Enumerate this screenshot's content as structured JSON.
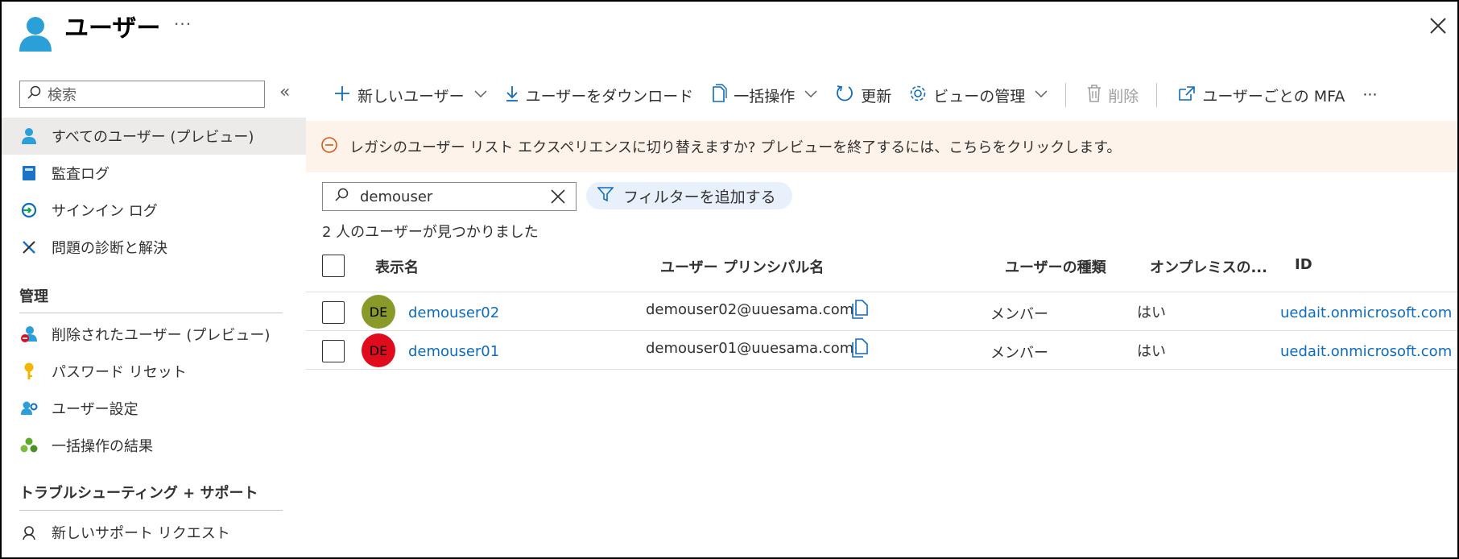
{
  "header": {
    "title": "ユーザー",
    "more": "···"
  },
  "sidebar": {
    "search_placeholder": "検索",
    "collapse": "«",
    "items": [
      {
        "label": "すべてのユーザー (プレビュー)",
        "icon": "user-icon"
      },
      {
        "label": "監査ログ",
        "icon": "book-icon"
      },
      {
        "label": "サインイン ログ",
        "icon": "signin-icon"
      },
      {
        "label": "問題の診断と解決",
        "icon": "wrench-icon"
      }
    ],
    "section_manage": "管理",
    "manage_items": [
      {
        "label": "削除されたユーザー (プレビュー)",
        "icon": "deleted-user-icon"
      },
      {
        "label": "パスワード リセット",
        "icon": "key-icon"
      },
      {
        "label": "ユーザー設定",
        "icon": "user-settings-icon"
      },
      {
        "label": "一括操作の結果",
        "icon": "bulk-results-icon"
      }
    ],
    "section_support": "トラブルシューティング + サポート",
    "support_items": [
      {
        "label": "新しいサポート リクエスト",
        "icon": "support-icon"
      }
    ]
  },
  "toolbar": {
    "new_user": "新しいユーザー",
    "download": "ユーザーをダウンロード",
    "bulk": "一括操作",
    "refresh": "更新",
    "manage_view": "ビューの管理",
    "delete": "削除",
    "mfa": "ユーザーごとの MFA",
    "more": "···"
  },
  "banner": {
    "text": "レガシのユーザー リスト エクスペリエンスに切り替えますか? プレビューを終了するには、こちらをクリックします。"
  },
  "search": {
    "value": "demouser"
  },
  "filter": {
    "label": "フィルターを追加する"
  },
  "result_count": "2 人のユーザーが見つかりました",
  "table": {
    "headers": {
      "display_name": "表示名",
      "upn": "ユーザー プリンシパル名",
      "user_type": "ユーザーの種類",
      "on_prem": "オンプレミスの...",
      "id": "ID"
    },
    "rows": [
      {
        "initials": "DE",
        "avatar_color": "#8a9a2a",
        "name": "demouser02",
        "upn": "demouser02@uuesama.com",
        "type": "メンバー",
        "on_prem": "はい",
        "id": "uedait.onmicrosoft.com"
      },
      {
        "initials": "DE",
        "avatar_color": "#e00b1c",
        "name": "demouser01",
        "upn": "demouser01@uuesama.com",
        "type": "メンバー",
        "on_prem": "はい",
        "id": "uedait.onmicrosoft.com"
      }
    ]
  }
}
